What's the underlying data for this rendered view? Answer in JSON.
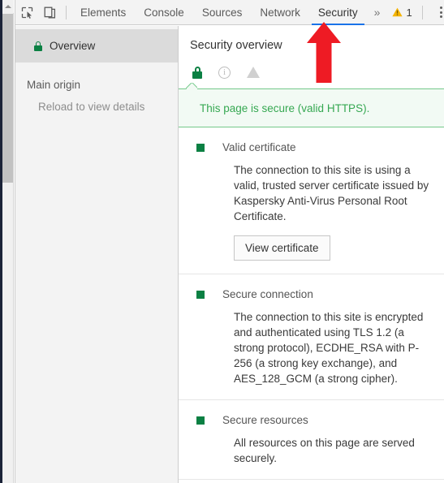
{
  "toolbar": {
    "inspect_icon": "inspect-element-icon",
    "device_icon": "device-toolbar-icon",
    "tabs": [
      {
        "label": "Elements",
        "active": false
      },
      {
        "label": "Console",
        "active": false
      },
      {
        "label": "Sources",
        "active": false
      },
      {
        "label": "Network",
        "active": false
      },
      {
        "label": "Security",
        "active": true
      }
    ],
    "more_tabs_label": "»",
    "warning_icon": "warning-triangle-icon",
    "warning_count": "1",
    "menu_icon": "vertical-dots-icon"
  },
  "sidebar": {
    "overview": {
      "label": "Overview",
      "icon": "green-lock-icon"
    },
    "group_label": "Main origin",
    "group_placeholder": "Reload to view details"
  },
  "main": {
    "title": "Security overview",
    "summary_icons": [
      {
        "name": "lock-icon",
        "state": "secure"
      },
      {
        "name": "info-circle-icon",
        "state": "inactive"
      },
      {
        "name": "warning-triangle-icon",
        "state": "inactive"
      }
    ],
    "callout": {
      "text": "This page is secure (valid HTTPS).",
      "color": "#36a852",
      "background": "#f2faf4",
      "border": "#74c98a"
    },
    "sections": [
      {
        "title": "Valid certificate",
        "body": "The connection to this site is using a valid, trusted server certificate issued by Kaspersky Anti-Virus Personal Root Certificate.",
        "button": "View certificate",
        "status_color": "#0b8043"
      },
      {
        "title": "Secure connection",
        "body": "The connection to this site is encrypted and authenticated using TLS 1.2 (a strong protocol), ECDHE_RSA with P-256 (a strong key exchange), and AES_128_GCM (a strong cipher).",
        "button": null,
        "status_color": "#0b8043"
      },
      {
        "title": "Secure resources",
        "body": "All resources on this page are served securely.",
        "button": null,
        "status_color": "#0b8043"
      }
    ]
  },
  "annotation": {
    "arrow_icon": "red-up-arrow-icon",
    "arrow_color": "#ee1b24"
  },
  "scrollbar": {
    "up_arrow_icon": "scroll-up-arrow-icon"
  }
}
